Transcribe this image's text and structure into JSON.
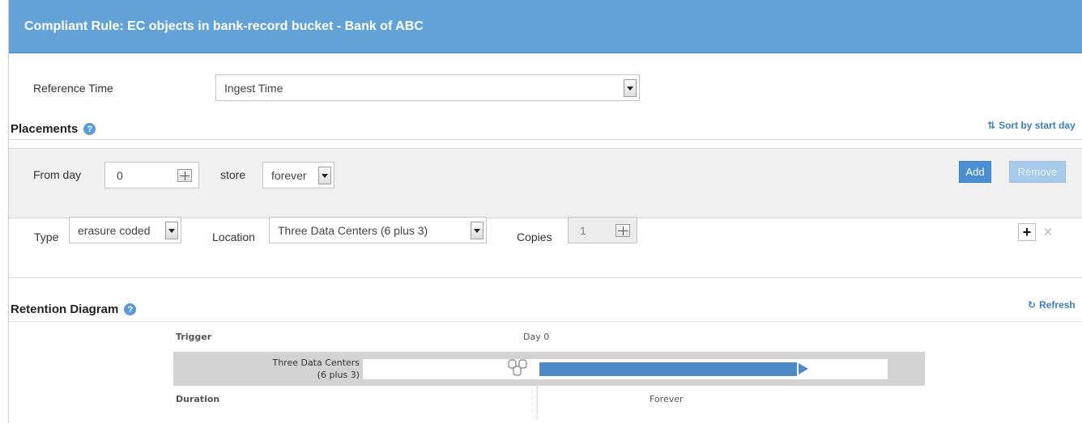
{
  "header": {
    "title": "Compliant Rule: EC objects in bank-record bucket - Bank of ABC"
  },
  "reference_time": {
    "label": "Reference Time",
    "value": "Ingest Time"
  },
  "placements": {
    "title": "Placements",
    "sort_link": "Sort by start day",
    "from_day_label": "From day",
    "from_day_value": "0",
    "store_label": "store",
    "store_value": "forever",
    "add_button": "Add",
    "remove_button": "Remove",
    "type_label": "Type",
    "type_value": "erasure coded",
    "location_label": "Location",
    "location_value": "Three Data Centers (6 plus 3)",
    "copies_label": "Copies",
    "copies_value": "1"
  },
  "retention": {
    "title": "Retention Diagram",
    "refresh_link": "Refresh",
    "trigger_label": "Trigger",
    "day_label": "Day 0",
    "location_line1": "Three Data Centers",
    "location_line2": "(6 plus 3)",
    "duration_label": "Duration",
    "duration_value": "Forever"
  },
  "colors": {
    "header_bg": "#62a2d6",
    "accent": "#3a7fc1",
    "bar": "#4d8ac6"
  },
  "icons": [
    "help-icon",
    "sort-icon",
    "refresh-icon",
    "dropdown-arrow-icon",
    "spinner-icon",
    "plus-icon",
    "close-icon",
    "storage-icon"
  ]
}
